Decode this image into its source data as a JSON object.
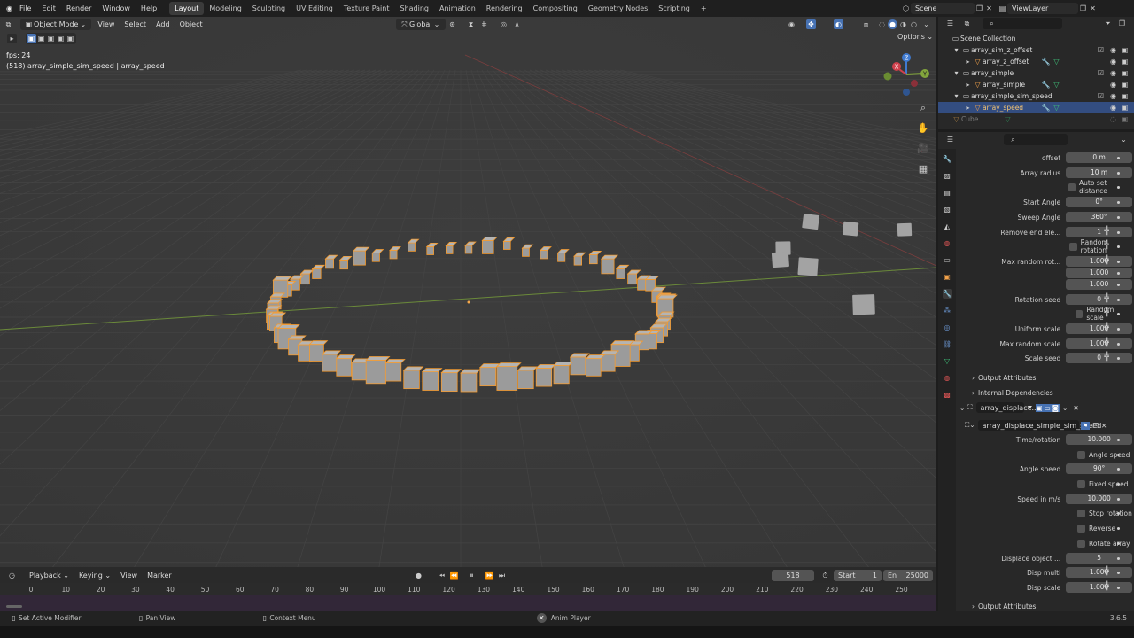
{
  "topbar": {
    "menus": [
      "File",
      "Edit",
      "Render",
      "Window",
      "Help"
    ],
    "workspaces": [
      "Layout",
      "Modeling",
      "Sculpting",
      "UV Editing",
      "Texture Paint",
      "Shading",
      "Animation",
      "Rendering",
      "Compositing",
      "Geometry Nodes",
      "Scripting"
    ],
    "active_workspace": "Layout",
    "scene": "Scene",
    "view_layer": "ViewLayer"
  },
  "viewport": {
    "mode": "Object Mode",
    "menus": [
      "View",
      "Select",
      "Add",
      "Object"
    ],
    "orientation": "Global",
    "options_label": "Options",
    "fps_text": "fps: 24",
    "object_info": "(518) array_simple_sim_speed | array_speed",
    "gizmo": {
      "x": "X",
      "y": "Y",
      "z": "Z"
    }
  },
  "outliner": {
    "root": "Scene Collection",
    "rows": [
      {
        "label": "array_sim_z_offset",
        "kind": "collection"
      },
      {
        "label": "array_z_offset",
        "kind": "object"
      },
      {
        "label": "array_simple",
        "kind": "collection"
      },
      {
        "label": "array_simple",
        "kind": "object"
      },
      {
        "label": "array_simple_sim_speed",
        "kind": "collection"
      },
      {
        "label": "array_speed",
        "kind": "object",
        "selected": true
      },
      {
        "label": "Cube",
        "kind": "object",
        "dimmed": true
      }
    ]
  },
  "properties": {
    "rows": [
      {
        "label": "offset",
        "value": "0 m"
      },
      {
        "label": "Array radius",
        "value": "10 m"
      },
      {
        "check": "Auto set distance"
      },
      {
        "label": "Start Angle",
        "value": "0°"
      },
      {
        "label": "Sweep Angle",
        "value": "360°"
      },
      {
        "label": "Remove end ele...",
        "value": "1",
        "grid": true
      },
      {
        "check": "Random rotation",
        "grid": true
      },
      {
        "label": "Max random rot...",
        "value": "1.000",
        "grid": true
      },
      {
        "label": "",
        "value": "1.000"
      },
      {
        "label": "",
        "value": "1.000"
      },
      {
        "label": "Rotation seed",
        "value": "0",
        "grid": true
      },
      {
        "check": "Random scale",
        "grid": true
      },
      {
        "label": "Uniform scale",
        "value": "1.000",
        "grid": true
      },
      {
        "label": "Max random scale",
        "value": "1.000",
        "grid": true
      },
      {
        "label": "Scale seed",
        "value": "0",
        "grid": true
      }
    ],
    "subpanels": [
      "Output Attributes",
      "Internal Dependencies"
    ],
    "modifier_name": "array_displace...",
    "node_group": "array_displace_simple_sim_speed",
    "mod_rows": [
      {
        "label": "Time/rotation",
        "value": "10.000"
      },
      {
        "check": "Angle speed"
      },
      {
        "label": "Angle speed",
        "value": "90°"
      },
      {
        "check": "Fixed speed"
      },
      {
        "label": "Speed in m/s",
        "value": "10.000"
      },
      {
        "check": "Stop rotation"
      },
      {
        "check": "Reverse"
      },
      {
        "check": "Rotate array"
      },
      {
        "label": "Displace object ...",
        "value": "5"
      },
      {
        "label": "Disp multi",
        "value": "1.000",
        "grid": true
      },
      {
        "label": "Disp scale",
        "value": "1.000",
        "grid": true
      }
    ],
    "mod_subpanel": "Output Attributes"
  },
  "timeline": {
    "menus": [
      "Playback",
      "Keying",
      "View",
      "Marker"
    ],
    "current_frame": "518",
    "start_label": "Start",
    "start_value": "1",
    "end_label": "En",
    "end_value": "25000",
    "ticks": [
      "0",
      "10",
      "20",
      "30",
      "40",
      "50",
      "60",
      "70",
      "80",
      "90",
      "100",
      "110",
      "120",
      "130",
      "140",
      "150",
      "160",
      "170",
      "180",
      "190",
      "200",
      "210",
      "220",
      "230",
      "240",
      "250"
    ]
  },
  "statusbar": {
    "left": "Set Active Modifier",
    "middle": "Pan View",
    "right": "Context Menu",
    "center": "Anim Player",
    "version": "3.6.5"
  }
}
